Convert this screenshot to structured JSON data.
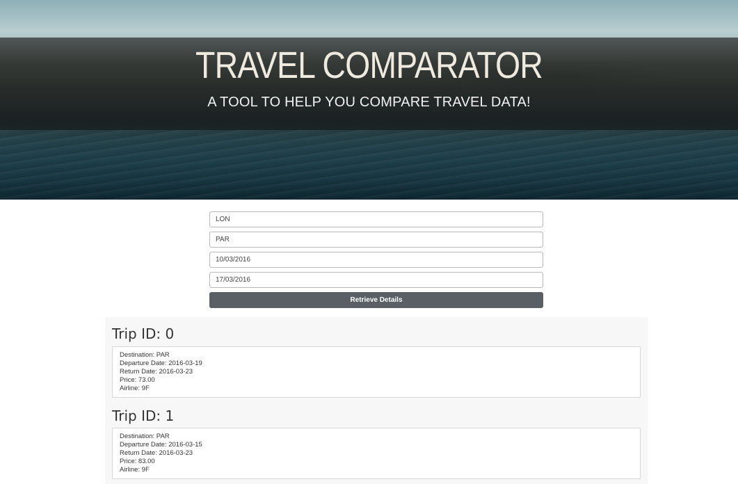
{
  "hero": {
    "title": "TRAVEL COMPARATOR",
    "subtitle": "A TOOL TO HELP YOU COMPARE TRAVEL DATA!"
  },
  "form": {
    "origin_value": "LON",
    "destination_value": "PAR",
    "departure_value": "10/03/2016",
    "return_value": "17/03/2016",
    "submit_label": "Retrieve Details"
  },
  "trips": [
    {
      "title": "Trip ID: 0",
      "destination": "Destination: PAR",
      "departure": "Departure Date: 2016-03-19",
      "return": "Return Date: 2016-03-23",
      "price": "Price: 73.00",
      "airline": "Airline: 9F"
    },
    {
      "title": "Trip ID: 1",
      "destination": "Destination: PAR",
      "departure": "Departure Date: 2016-03-15",
      "return": "Return Date: 2016-03-23",
      "price": "Price: 83.00",
      "airline": "Airline: 9F"
    }
  ],
  "colors": {
    "button_bg": "#5a5f66",
    "hero_band": "rgba(20,20,20,0.62)",
    "results_bg": "#f7f7f7"
  }
}
